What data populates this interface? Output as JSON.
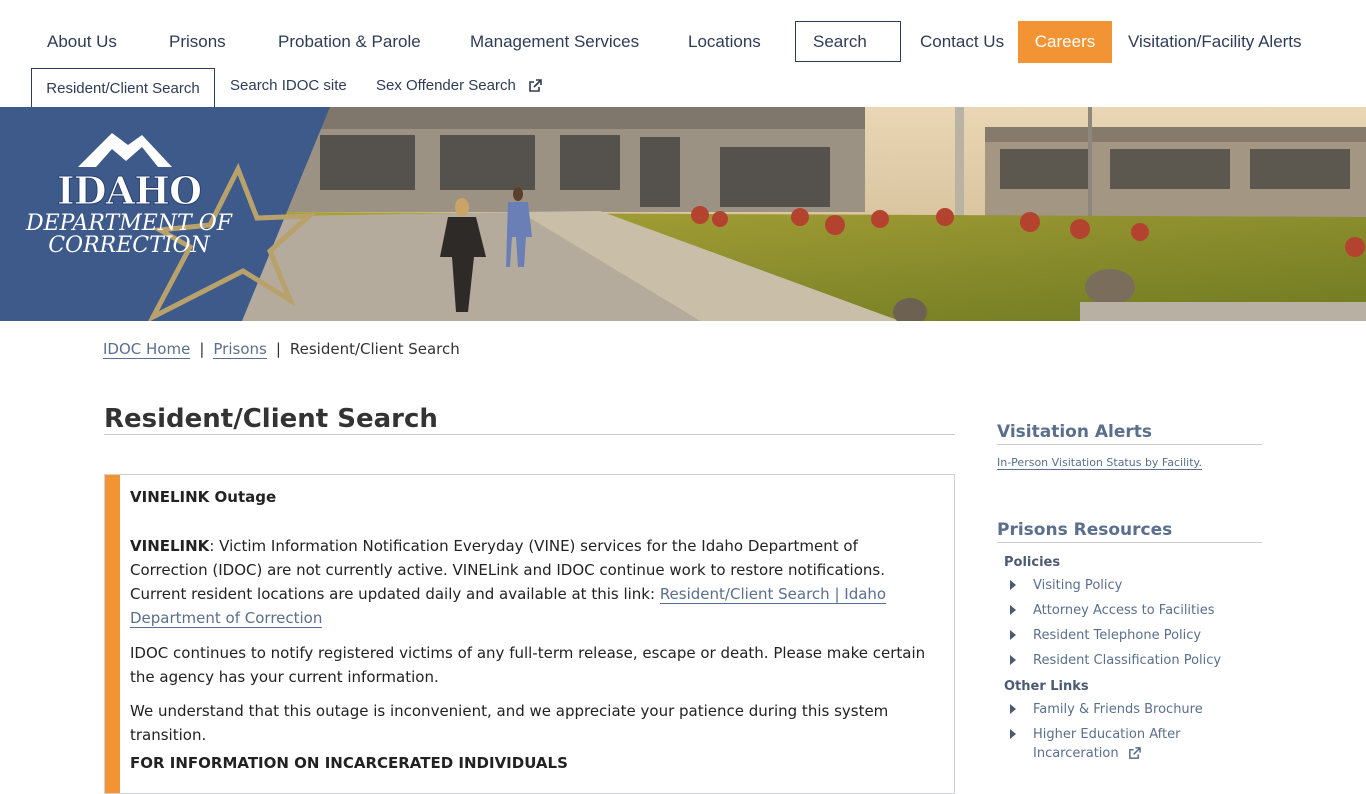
{
  "nav": {
    "about": "About Us",
    "prisons": "Prisons",
    "probation": "Probation & Parole",
    "management": "Management Services",
    "locations": "Locations",
    "search": "Search",
    "contact": "Contact Us",
    "careers": "Careers",
    "alerts": "Visitation/Facility Alerts"
  },
  "subnav": {
    "resident": "Resident/Client Search",
    "site": "Search IDOC site",
    "sex_offender": "Sex Offender Search"
  },
  "logo": {
    "line1": "IDAHO",
    "line2": "DEPARTMENT OF",
    "line3": "CORRECTION"
  },
  "breadcrumb": {
    "home": "IDOC Home",
    "prisons": "Prisons",
    "current": "Resident/Client Search",
    "separator": "|"
  },
  "main": {
    "title": "Resident/Client Search",
    "notice": {
      "heading": "VINELINK Outage",
      "p1_bold": "VINELINK",
      "p1_text": ": Victim Information Notification Everyday (VINE) services for the Idaho Department of Correction (IDOC) are not currently active. VINELink and IDOC continue work to restore notifications. Current resident locations are updated daily and available at this link: ",
      "p1_link": "Resident/Client Search | Idaho Department of Correction",
      "p2": "IDOC continues to notify registered victims of any full-term release, escape or death. Please make certain the agency has your current information.",
      "p3": "We understand that this outage is inconvenient, and we appreciate your patience during this system transition.",
      "p4": "FOR INFORMATION ON INCARCERATED INDIVIDUALS"
    }
  },
  "sidebar": {
    "visitation": {
      "heading": "Visitation Alerts",
      "link": "In-Person Visitation Status by Facility."
    },
    "resources": {
      "heading": "Prisons Resources",
      "policies_label": "Policies",
      "policies": [
        "Visiting Policy",
        "Attorney Access to Facilities",
        "Resident Telephone Policy",
        "Resident Classification Policy"
      ],
      "other_label": "Other Links",
      "other": [
        "Family & Friends Brochure",
        "Higher Education After Incarceration"
      ]
    }
  },
  "colors": {
    "accent": "#f29433",
    "navy": "#2f3c56",
    "link": "#5a6f8c",
    "logo_blue": "#3d5a8a",
    "star_gold": "#b9a16b"
  }
}
